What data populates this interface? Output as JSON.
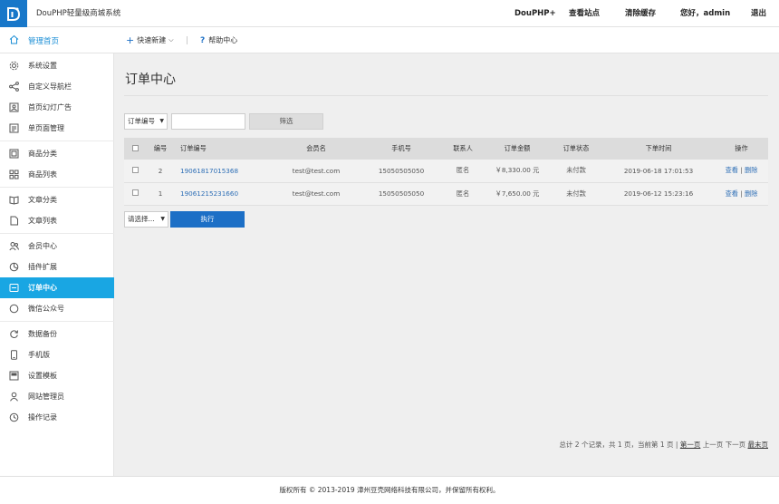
{
  "header": {
    "site_name": "DouPHP轻量级商城系统",
    "nav": [
      "DouPHP+",
      "查看站点",
      "清除缓存",
      "您好，admin",
      "退出"
    ]
  },
  "subbar": {
    "home": "管理首页",
    "quick_add": "快速新建",
    "help": "帮助中心"
  },
  "sidebar": {
    "items": [
      {
        "label": "系统设置",
        "icon": "gear-icon"
      },
      {
        "label": "自定义导航栏",
        "icon": "share-icon"
      },
      {
        "label": "首页幻灯广告",
        "icon": "image-icon"
      },
      {
        "label": "单页面管理",
        "icon": "page-icon"
      },
      {
        "label": "商品分类",
        "icon": "category-icon"
      },
      {
        "label": "商品列表",
        "icon": "grid-icon"
      },
      {
        "label": "文章分类",
        "icon": "book-icon"
      },
      {
        "label": "文章列表",
        "icon": "file-icon"
      },
      {
        "label": "会员中心",
        "icon": "users-icon"
      },
      {
        "label": "插件扩展",
        "icon": "plugin-icon"
      },
      {
        "label": "订单中心",
        "icon": "order-icon",
        "active": true
      },
      {
        "label": "微信公众号",
        "icon": "wechat-icon"
      },
      {
        "label": "数据备份",
        "icon": "refresh-icon"
      },
      {
        "label": "手机版",
        "icon": "mobile-icon"
      },
      {
        "label": "设置模板",
        "icon": "template-icon"
      },
      {
        "label": "网站管理员",
        "icon": "user-icon"
      },
      {
        "label": "操作记录",
        "icon": "clock-icon"
      }
    ]
  },
  "main": {
    "title": "订单中心",
    "filter": {
      "field_select": "订单编号",
      "keyword_value": "",
      "submit": "筛选"
    },
    "table": {
      "headers": [
        "",
        "编号",
        "订单编号",
        "会员名",
        "手机号",
        "联系人",
        "订单金额",
        "订单状态",
        "下单时间",
        "操作"
      ],
      "rows": [
        {
          "id": "2",
          "order_no": "19061817015368",
          "member": "test@test.com",
          "phone": "15050505050",
          "contact": "匿名",
          "amount": "￥8,330.00 元",
          "status": "未付款",
          "time": "2019-06-18 17:01:53",
          "view": "查看",
          "sep": "|",
          "delete": "删除"
        },
        {
          "id": "1",
          "order_no": "19061215231660",
          "member": "test@test.com",
          "phone": "15050505050",
          "contact": "匿名",
          "amount": "￥7,650.00 元",
          "status": "未付款",
          "time": "2019-06-12 15:23:16",
          "view": "查看",
          "sep": "|",
          "delete": "删除"
        }
      ]
    },
    "batch": {
      "select": "请选择...",
      "execute": "执行"
    },
    "pager": {
      "summary": "总计 2 个记录，共 1 页，当前第 1 页 |",
      "first": "第一页",
      "prev": "上一页",
      "next": "下一页",
      "last": "最末页"
    }
  },
  "footer": {
    "copyright": "版权所有 © 2013-2019 漳州豆壳网络科技有限公司，并保留所有权利。"
  },
  "colors": {
    "brand_blue": "#1877c9",
    "sidebar_active": "#19a6e3",
    "link": "#2e6fb6",
    "execute_button": "#1c6fc6"
  }
}
